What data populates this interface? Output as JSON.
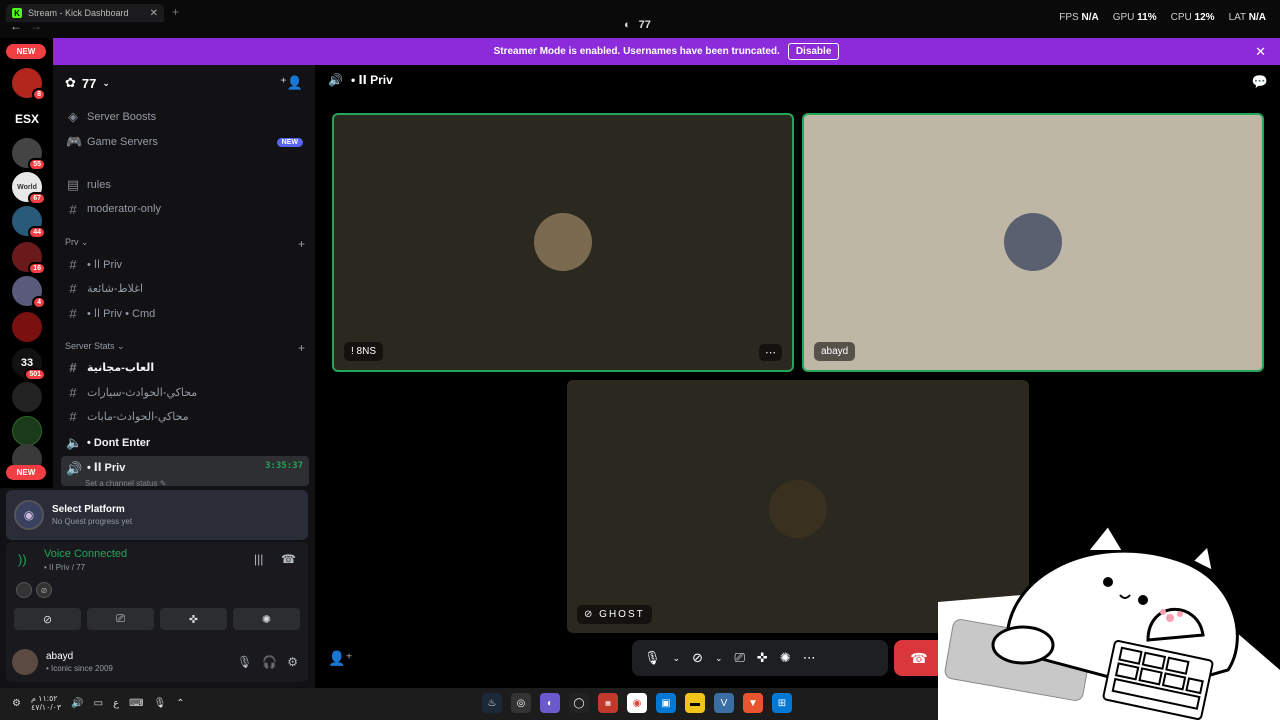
{
  "browser": {
    "tab_title": "Stream - Kick Dashboard",
    "new_tab": "+",
    "center_title": "77",
    "stats": [
      {
        "label": "FPS",
        "value": "N/A"
      },
      {
        "label": "GPU",
        "value": "11%"
      },
      {
        "label": "CPU",
        "value": "12%"
      },
      {
        "label": "LAT",
        "value": "N/A"
      }
    ]
  },
  "banner": {
    "text": "Streamer Mode is enabled. Usernames have been truncated.",
    "button": "Disable"
  },
  "rail": {
    "new_label": "NEW",
    "servers": [
      {
        "label": "",
        "count": "8",
        "color": "#b3261e"
      },
      {
        "label": "ESX",
        "count": "",
        "color": "#000000"
      },
      {
        "label": "",
        "count": "55",
        "color": "#444444"
      },
      {
        "label": "World",
        "count": "67",
        "color": "#e8e8e8"
      },
      {
        "label": "",
        "count": "44",
        "color": "#2a5a7a"
      },
      {
        "label": "",
        "count": "16",
        "color": "#6a1a1a"
      },
      {
        "label": "",
        "count": "4",
        "color": "#5a5a7a"
      },
      {
        "label": "",
        "count": "",
        "color": "#7a1010"
      },
      {
        "label": "33",
        "count": "501",
        "color": "#111111"
      },
      {
        "label": "",
        "count": "",
        "color": "#222222"
      },
      {
        "label": "",
        "count": "",
        "color": "#1a3a1a"
      },
      {
        "label": "",
        "count": "",
        "color": "#3a3a3a"
      }
    ]
  },
  "sidebar": {
    "server_name": "77",
    "items": {
      "boosts": "Server Boosts",
      "game_servers": "Game Servers",
      "game_servers_badge": "NEW",
      "rules": "rules",
      "moderator": "moderator-only",
      "cat_prv": "Prv",
      "priv1": "• اا Priv",
      "arabic1": "اغلاط-شائعة",
      "priv_cmd": "• اا Priv • Cmd",
      "cat_stats": "Server Stats",
      "arabic2": "العاب-مجانية",
      "arabic3": "محاكي-الحوادث-سيارات",
      "arabic4": "محاكي-الحوادث-مابات",
      "dont_enter": "• Dont Enter",
      "priv_voice": "• اا Priv",
      "priv_time": "3:35:37",
      "status_hint": "Set a channel status"
    }
  },
  "quest": {
    "title": "Select Platform",
    "subtitle": "No Quest progress yet"
  },
  "voice": {
    "title": "Voice Connected",
    "subtitle": "• اا Priv / 77"
  },
  "user": {
    "name": "abayd",
    "status": "• Iconic since 2009"
  },
  "stage": {
    "channel": "• اا Priv",
    "tiles": [
      {
        "name": "! 8NS"
      },
      {
        "name": "abayd"
      },
      {
        "name": "GHOST"
      }
    ]
  },
  "taskbar": {
    "time": "١١:٥٢ م",
    "date": "٤٧/١٠/٠٣",
    "lang": "ع"
  }
}
